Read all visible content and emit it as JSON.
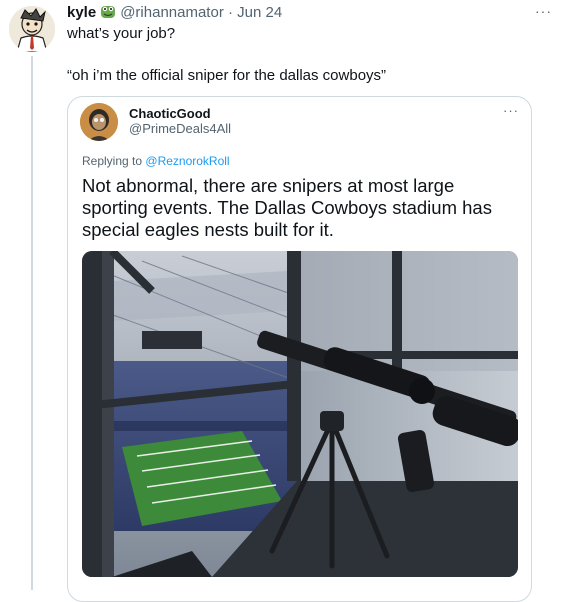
{
  "tweet": {
    "author_name": "kyle",
    "badge_icon": "frog-emoji-icon",
    "handle": "@rihannamator",
    "separator": "·",
    "date": "Jun 24",
    "more_icon": "···",
    "line1": "what’s your job?",
    "line2": "“oh i’m the official sniper for the dallas cowboys”"
  },
  "quoted_tweet": {
    "author_name": "ChaoticGood",
    "handle": "@PrimeDeals4All",
    "more_icon": "···",
    "replying_prefix": "Replying to",
    "replying_to": "@ReznorokRoll",
    "body": "Not abnormal, there are snipers at most large sporting events. The Dallas Cowboys stadium has special eagles nests built for it.",
    "image_icon": "stadium-sniper-photo"
  },
  "colors": {
    "text": "#0f1419",
    "muted": "#536471",
    "link": "#1d9bf0",
    "border": "#cfd9de"
  }
}
